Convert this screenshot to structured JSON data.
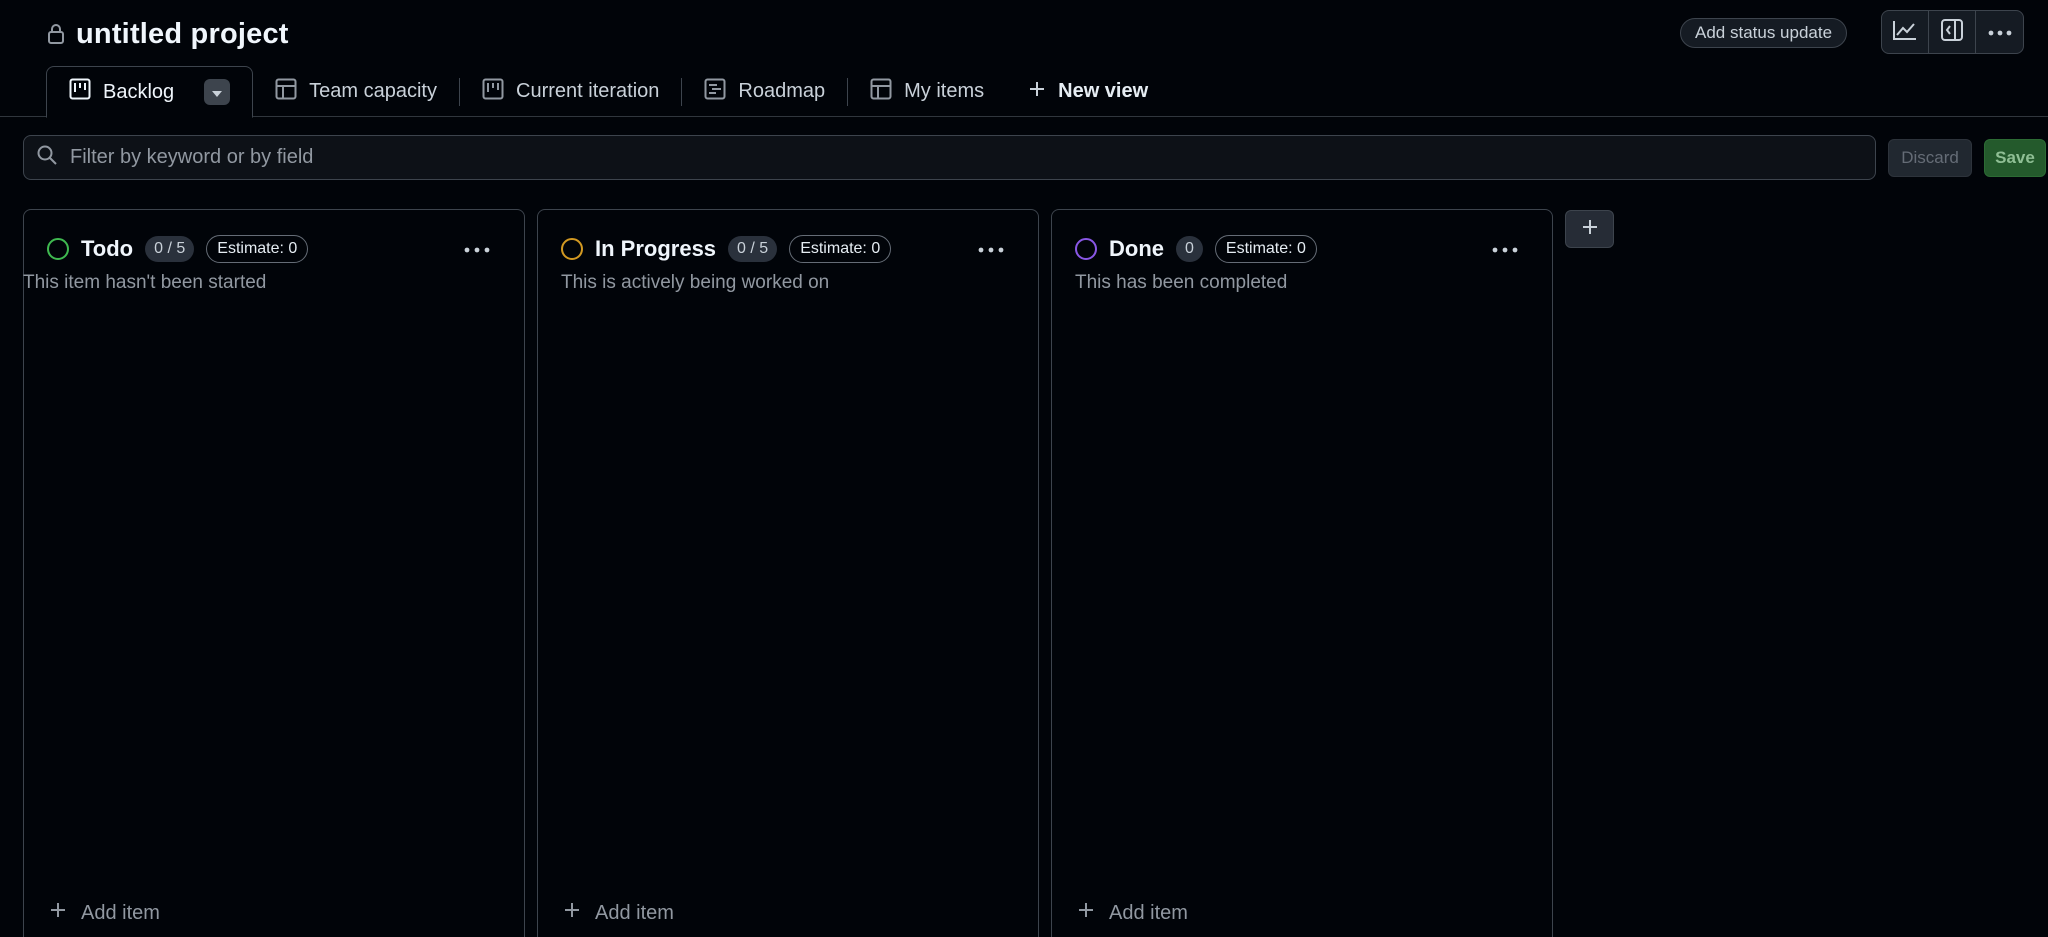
{
  "project": {
    "title": "untitled project"
  },
  "header": {
    "status_update_label": "Add status update"
  },
  "tabs": [
    {
      "label": "Backlog",
      "icon": "board-icon"
    },
    {
      "label": "Team capacity",
      "icon": "table-icon"
    },
    {
      "label": "Current iteration",
      "icon": "board-icon"
    },
    {
      "label": "Roadmap",
      "icon": "roadmap-icon"
    },
    {
      "label": "My items",
      "icon": "table-icon"
    }
  ],
  "new_view_label": "New view",
  "filter": {
    "placeholder": "Filter by keyword or by field"
  },
  "actions": {
    "discard_label": "Discard",
    "save_label": "Save"
  },
  "columns": [
    {
      "name": "Todo",
      "count": "0 / 5",
      "estimate": "Estimate: 0",
      "description": "This item hasn't been started",
      "color": "#3fb950"
    },
    {
      "name": "In Progress",
      "count": "0 / 5",
      "estimate": "Estimate: 0",
      "description": "This is actively being worked on",
      "color": "#d29922"
    },
    {
      "name": "Done",
      "count": "0",
      "estimate": "Estimate: 0",
      "description": "This has been completed",
      "color": "#8957e5"
    }
  ],
  "add_item_label": "Add item",
  "colors": {
    "background": "#010409",
    "border": "#3d444d",
    "save_green": "#245a2c"
  }
}
